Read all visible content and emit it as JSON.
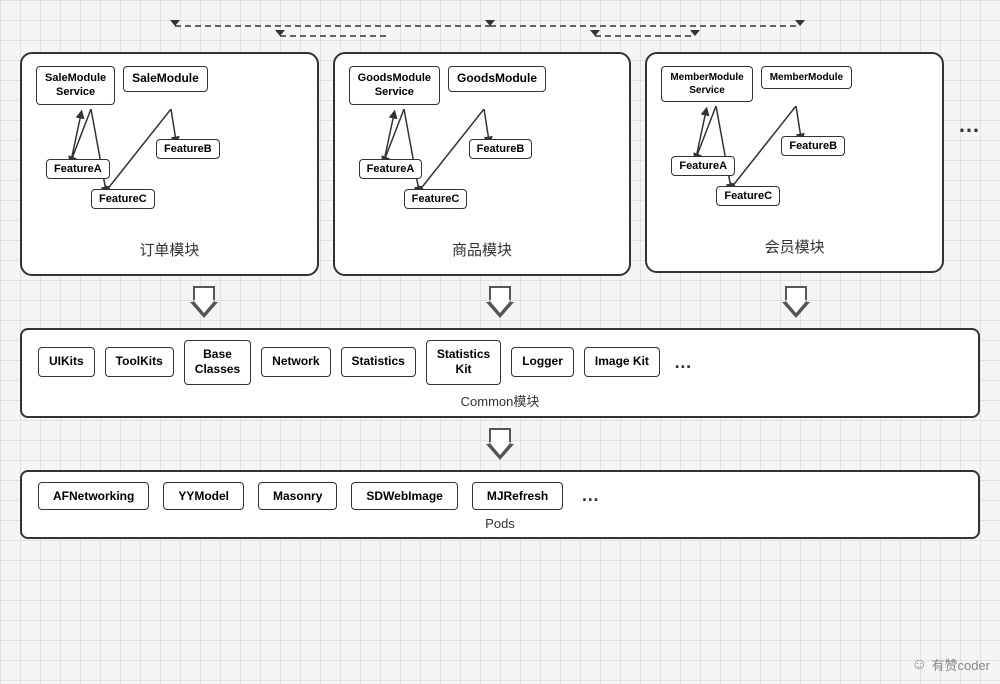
{
  "modules": [
    {
      "id": "sale",
      "service_label": "SaleModule\nService",
      "module_label": "SaleModule",
      "group_label": "订单模块",
      "features": [
        "FeatureA",
        "FeatureB",
        "FeatureC"
      ]
    },
    {
      "id": "goods",
      "service_label": "GoodsModule\nService",
      "module_label": "GoodsModule",
      "group_label": "商品模块",
      "features": [
        "FeatureA",
        "FeatureB",
        "FeatureC"
      ]
    },
    {
      "id": "member",
      "service_label": "MemberModule\nService",
      "module_label": "MemberModule",
      "group_label": "会员模块",
      "features": [
        "FeatureA",
        "FeatureB",
        "FeatureC"
      ]
    }
  ],
  "common": {
    "label": "Common模块",
    "items": [
      "UIKits",
      "ToolKits",
      "Base\nClasses",
      "Network",
      "Statistics",
      "Statistics\nKit",
      "Logger",
      "Image Kit"
    ]
  },
  "pods": {
    "label": "Pods",
    "items": [
      "AFNetworking",
      "YYModel",
      "Masonry",
      "SDWebImage",
      "MJRefresh"
    ]
  },
  "watermark": "有赞coder"
}
